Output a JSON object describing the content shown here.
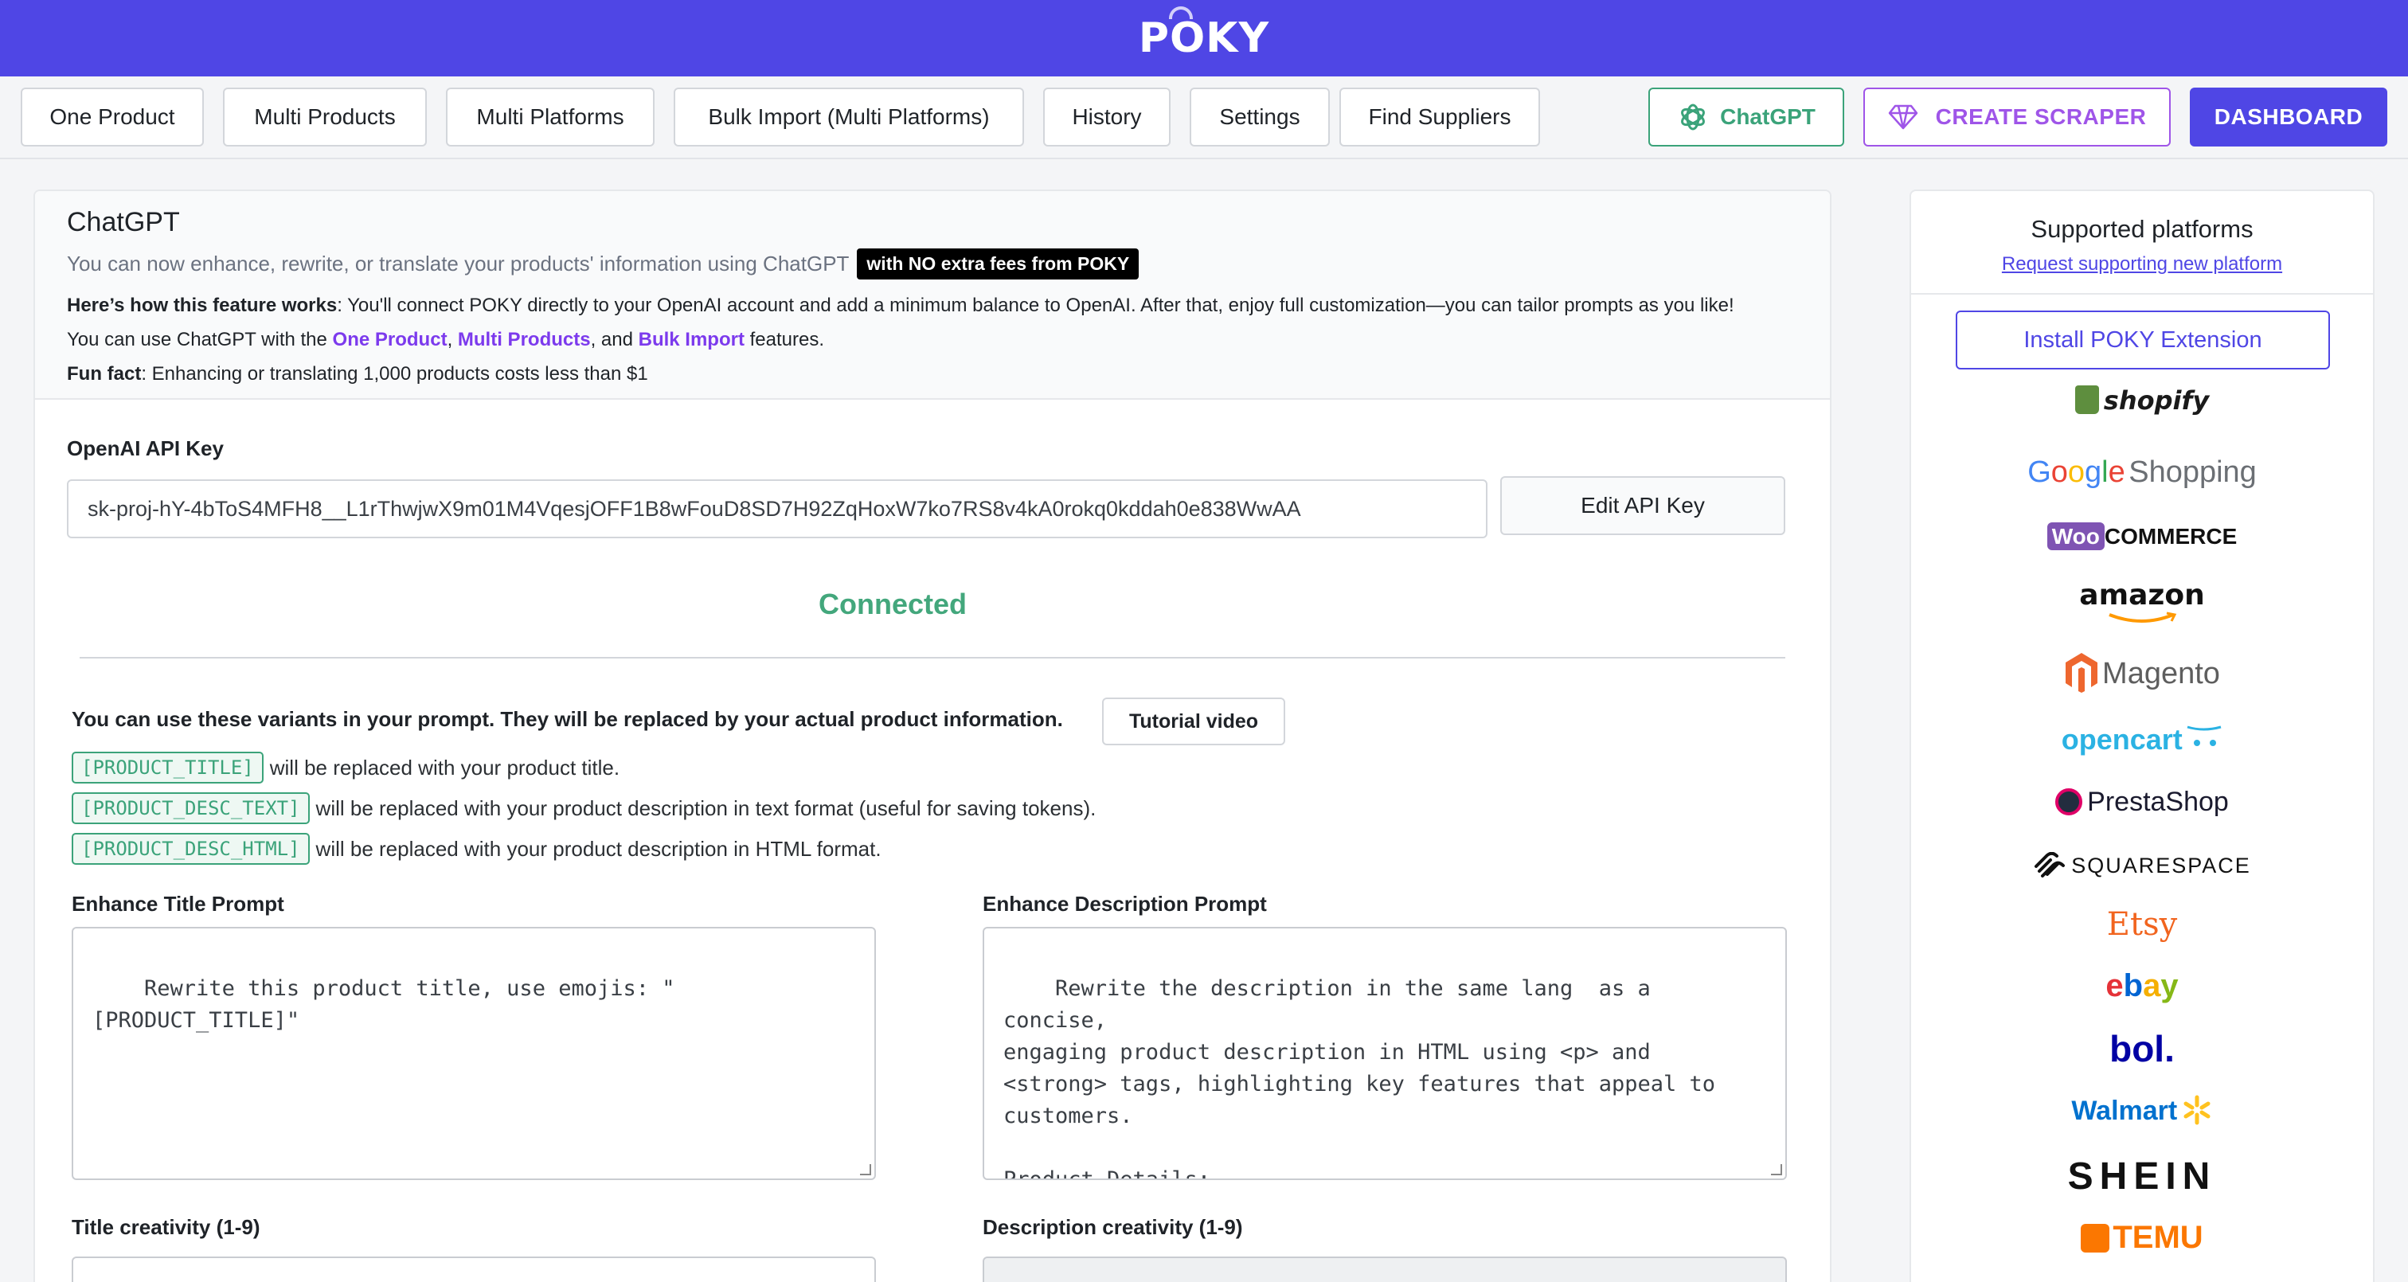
{
  "brand": {
    "name": "POKY"
  },
  "nav": {
    "one_product": "One Product",
    "multi_products": "Multi Products",
    "multi_platforms": "Multi Platforms",
    "bulk_import": "Bulk Import (Multi Platforms)",
    "history": "History",
    "settings": "Settings",
    "find_suppliers": "Find Suppliers",
    "chatgpt": "ChatGPT",
    "create_scraper": "CREATE SCRAPER",
    "dashboard": "DASHBOARD"
  },
  "header": {
    "title": "ChatGPT",
    "subtitle": "You can now enhance, rewrite, or translate your products' information using ChatGPT",
    "badge": "with NO extra fees from POKY",
    "how_bold": "Here’s how this feature works",
    "how_text": ": You'll connect POKY directly to your OpenAI account and add a minimum balance to OpenAI. After that, enjoy full customization—you can tailor prompts as you like!",
    "use_prefix": "You can use ChatGPT with the ",
    "use_link1": "One Product",
    "use_sep1": ", ",
    "use_link2": "Multi Products",
    "use_sep2": ", and ",
    "use_link3": "Bulk Import",
    "use_suffix": " features.",
    "fun_bold": "Fun fact",
    "fun_text": ": Enhancing or translating 1,000 products costs less than $1"
  },
  "api": {
    "label": "OpenAI API Key",
    "value": "sk-proj-hY-4bToS4MFH8__L1rThwjwX9m01M4VqesjOFF1B8wFouD8SD7H92ZqHoxW7ko7RS8v4kA0rokq0kddah0e838WwAA",
    "edit_button": "Edit API Key",
    "status": "Connected"
  },
  "variants": {
    "intro": "You can use these variants in your prompt. They will be replaced by your actual product information.",
    "tutorial_button": "Tutorial video",
    "items": [
      {
        "tag": "[PRODUCT_TITLE]",
        "desc": "will be replaced with your product title."
      },
      {
        "tag": "[PRODUCT_DESC_TEXT]",
        "desc": "will be replaced with your product description in text format (useful for saving tokens)."
      },
      {
        "tag": "[PRODUCT_DESC_HTML]",
        "desc": "will be replaced with your product description in HTML format."
      }
    ]
  },
  "prompts": {
    "title_label": "Enhance Title Prompt",
    "title_value": "Rewrite this product title, use emojis: \"\n[PRODUCT_TITLE]\"",
    "desc_label": "Enhance Description Prompt",
    "desc_value": "Rewrite the description in the same lang  as a concise,\nengaging product description in HTML using <p> and\n<strong> tags, highlighting key features that appeal to\ncustomers.\n\nProduct Details:\n[PRODUCT_DESC_TEXT]",
    "title_creativity_label": "Title creativity (1-9)",
    "desc_creativity_label": "Description creativity (1-9)"
  },
  "sidebar": {
    "title": "Supported platforms",
    "request_link": "Request supporting new platform",
    "install_button": "Install POKY Extension",
    "platforms": {
      "shopify": "shopify",
      "google_shopping": "Shopping",
      "woocommerce_a": "Woo",
      "woocommerce_b": "COMMERCE",
      "amazon": "amazon",
      "magento": "Magento",
      "opencart": "opencart",
      "prestashop": "PrestaShop",
      "squarespace": "SQUARESPACE",
      "etsy": "Etsy",
      "ebay": "ebay",
      "bol": "bol.",
      "walmart": "Walmart",
      "shein": "SHEIN",
      "temu": "TEMU"
    }
  },
  "colors": {
    "brand": "#4f46e5",
    "success": "#43a77c",
    "accent": "#9f55e8"
  }
}
